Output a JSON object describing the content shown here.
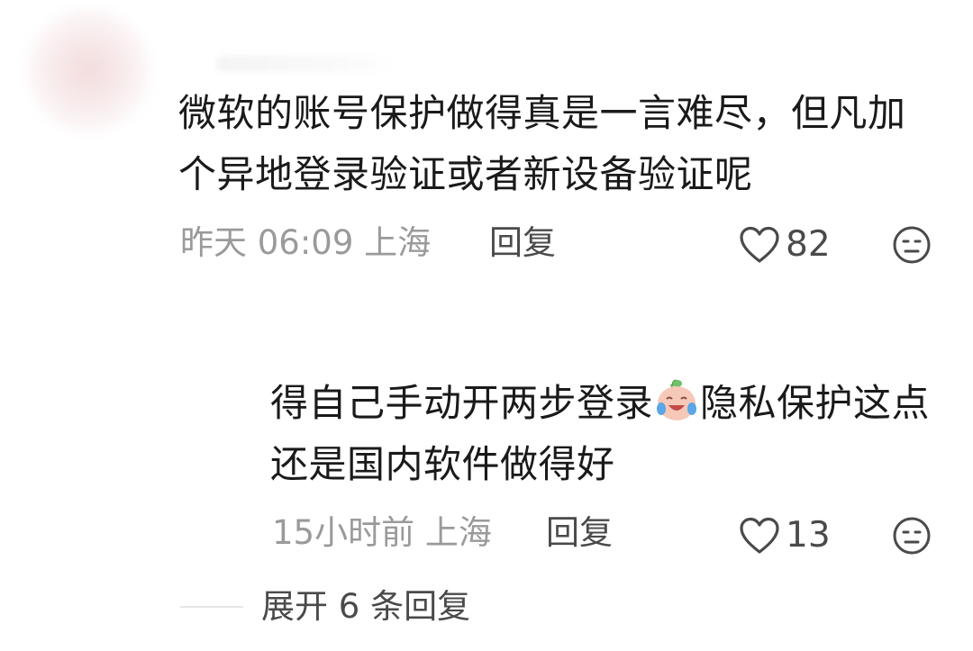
{
  "comments": [
    {
      "text": "微软的账号保护做得真是一言难尽，但凡加个异地登录验证或者新设备验证呢",
      "time": "昨天 06:09",
      "location": "上海",
      "reply_label": "回复",
      "likes": "82"
    },
    {
      "text_before_emoji": "得自己手动开两步登录",
      "emoji": "crying-laughing-emoji",
      "text_after_emoji": "隐私保护这点还是国内软件做得好",
      "time": "15小时前",
      "location": "上海",
      "reply_label": "回复",
      "likes": "13"
    }
  ],
  "expand_replies": "展开 6 条回复",
  "icons": {
    "like": "heart-outline-icon",
    "dislike": "neutral-face-icon"
  },
  "colors": {
    "text": "#1a1a1a",
    "meta": "#9a9a9a",
    "action": "#4a4a4a"
  }
}
